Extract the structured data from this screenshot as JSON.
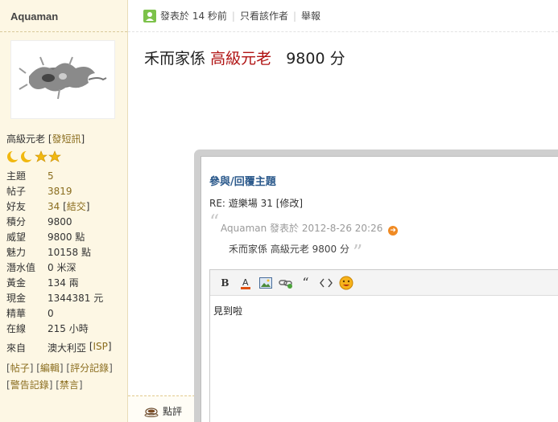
{
  "user": {
    "name": "Aquaman",
    "rank": "高級元老",
    "send_pm": "發短訊",
    "stars_icons": [
      "moon-icon",
      "moon-icon",
      "star-icon",
      "star-icon"
    ],
    "stats": [
      {
        "key": "主題",
        "value": "5",
        "link": true
      },
      {
        "key": "帖子",
        "value": "3819",
        "link": true
      },
      {
        "key": "好友",
        "value": "34",
        "link": true,
        "extra": "結交"
      },
      {
        "key": "積分",
        "value": "9800",
        "link": false
      },
      {
        "key": "威望",
        "value": "9800 點",
        "link": false
      },
      {
        "key": "魅力",
        "value": "10158 點",
        "link": false
      },
      {
        "key": "潛水值",
        "value": "0 米深",
        "link": false
      },
      {
        "key": "黃金",
        "value": "134 兩",
        "link": false
      },
      {
        "key": "現金",
        "value": "1344381 元",
        "link": false
      },
      {
        "key": "精華",
        "value": "0",
        "link": false
      },
      {
        "key": "在線",
        "value": "215 小時",
        "link": false
      }
    ],
    "from_label": "來自",
    "from_value": "澳大利亞",
    "from_isp": "ISP",
    "links_row1": [
      "帖子",
      "編輯",
      "評分記錄"
    ],
    "links_row2": [
      "警告記錄",
      "禁言"
    ]
  },
  "post": {
    "posted": "發表於 14 秒前",
    "only_author": "只看該作者",
    "report": "舉報",
    "body_prefix": "禾而家係",
    "body_rank": "高級元老",
    "body_score": "9800 分",
    "rate_label": "點評"
  },
  "popup": {
    "title": "參與/回覆主題",
    "subject": "RE: 遊樂場 31",
    "edit_link": "修改",
    "quote_meta": "Aquaman 發表於 2012-8-26 20:26",
    "quote_text": "禾而家係 高級元老  9800 分",
    "toolbar": [
      "bold-icon",
      "font-color-icon",
      "image-icon",
      "link-icon",
      "quote-icon",
      "code-icon",
      "smiley-icon"
    ],
    "editor_text": "見到啦"
  },
  "colors": {
    "sidebar_bg": "#fdf7e4",
    "link": "#8a6d1e",
    "rank_red": "#b01313",
    "title_blue": "#2c5a8c"
  }
}
